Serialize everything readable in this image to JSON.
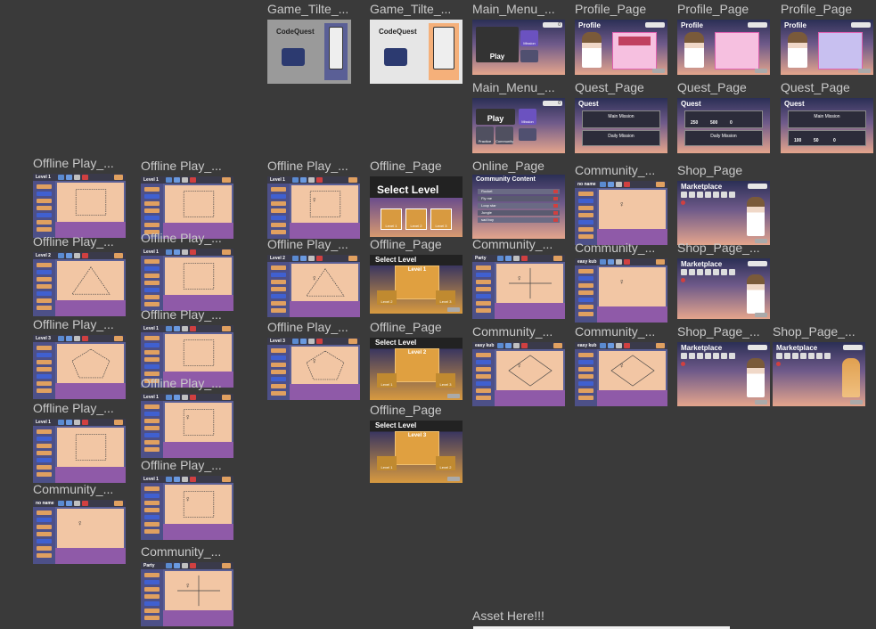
{
  "frames": [
    {
      "title": "Game_Tilte_...",
      "kind": "title",
      "logo": "CodeQuest",
      "variant": "gray"
    },
    {
      "title": "Game_Tilte_...",
      "kind": "title",
      "logo": "CodeQuest",
      "variant": "light"
    },
    {
      "title": "Main_Menu_...",
      "kind": "mainmenu",
      "play": "Play",
      "mission": "Mission",
      "coins": "0"
    },
    {
      "title": "Profile_Page",
      "kind": "profile",
      "header": "Profile",
      "coins": "0",
      "panel": "pinkinfo"
    },
    {
      "title": "Profile_Page",
      "kind": "profile",
      "header": "Profile",
      "coins": "0",
      "panel": "pink"
    },
    {
      "title": "Profile_Page",
      "kind": "profile",
      "header": "Profile",
      "coins": "0",
      "panel": "lavender"
    },
    {
      "title": "Main_Menu_...",
      "kind": "mainmenu2",
      "play": "Play",
      "mission": "Mission",
      "practice": "Practice",
      "community": "Community",
      "coins": "0"
    },
    {
      "title": "Quest_Page",
      "kind": "quest",
      "header": "Quest",
      "main": "Main Mission",
      "daily": "Daily Mission"
    },
    {
      "title": "Quest_Page",
      "kind": "quest2",
      "header": "Quest",
      "v1": "250",
      "v2": "500",
      "v3": "0",
      "daily": "Daily Mission"
    },
    {
      "title": "Quest_Page",
      "kind": "quest3",
      "header": "Quest",
      "main": "Main Mission",
      "v1": "100",
      "v2": "50",
      "v3": "0"
    },
    {
      "title": "Online_Page",
      "kind": "online",
      "header": "Community Content",
      "rows": [
        "Rocket",
        "Fly me",
        "Loop star",
        "Jungle",
        "sad boy"
      ]
    },
    {
      "title": "Community_...",
      "kind": "game",
      "level": "no name",
      "shape": "robot"
    },
    {
      "title": "Shop_Page",
      "kind": "shop",
      "header": "Marketplace",
      "coins": "0"
    },
    {
      "title": "Offline Play_...",
      "kind": "game",
      "level": "Level 1",
      "shape": "square",
      "extra": "Build"
    },
    {
      "title": "Offline Play_...",
      "kind": "game",
      "level": "Level 1",
      "shape": "square"
    },
    {
      "title": "Offline Play_...",
      "kind": "game",
      "level": "Level 1",
      "shape": "square-robot"
    },
    {
      "title": "Offline_Page",
      "kind": "select",
      "header": "Select Level",
      "levels": [
        "Level 1",
        "Level 2",
        "Level 3"
      ]
    },
    {
      "title": "Offline Play_...",
      "kind": "game",
      "level": "Level 2",
      "shape": "triangle"
    },
    {
      "title": "Offline Play_...",
      "kind": "game",
      "level": "Level 1",
      "shape": "square"
    },
    {
      "title": "Offline Play_...",
      "kind": "game",
      "level": "Level 2",
      "shape": "triangle-robot"
    },
    {
      "title": "Offline_Page",
      "kind": "sel1",
      "header": "Select Level",
      "level": "Level 1",
      "levels": [
        "Level 2",
        "Level 3"
      ]
    },
    {
      "title": "Community_...",
      "kind": "game",
      "level": "Party",
      "shape": "cross"
    },
    {
      "title": "Community_...",
      "kind": "game",
      "level": "easy kub",
      "shape": "robot"
    },
    {
      "title": "Shop_Page_...",
      "kind": "shop",
      "header": "Marketplace",
      "coins": "0"
    },
    {
      "title": "Offline Play_...",
      "kind": "game",
      "level": "Level 3",
      "shape": "pentagon"
    },
    {
      "title": "Offline Play_...",
      "kind": "game",
      "level": "Level 1",
      "shape": "square"
    },
    {
      "title": "Offline Play_...",
      "kind": "game",
      "level": "Level 3",
      "shape": "pentagon-robot"
    },
    {
      "title": "Offline_Page",
      "kind": "sel2",
      "header": "Select Level",
      "level": "Level 2",
      "levels": [
        "Level 1",
        "Level 3"
      ]
    },
    {
      "title": "Community_...",
      "kind": "game",
      "level": "easy kub",
      "shape": "diamond"
    },
    {
      "title": "Community_...",
      "kind": "game",
      "level": "easy kub",
      "shape": "diamond"
    },
    {
      "title": "Shop_Page_...",
      "kind": "shop",
      "header": "Marketplace",
      "coins": "0"
    },
    {
      "title": "Shop_Page_...",
      "kind": "shop2",
      "header": "Marketplace",
      "coins": "0"
    },
    {
      "title": "Offline Play_...",
      "kind": "game",
      "level": "Level 1",
      "shape": "square"
    },
    {
      "title": "Offline Play_...",
      "kind": "game",
      "level": "Level 1",
      "shape": "square-robot"
    },
    {
      "title": "Offline_Page",
      "kind": "sel3",
      "header": "Select Level",
      "level": "Level 3",
      "levels": [
        "Level 1",
        "Level 2"
      ]
    },
    {
      "title": "Community_...",
      "kind": "game",
      "level": "no name",
      "shape": "robot"
    },
    {
      "title": "Offline Play_...",
      "kind": "game",
      "level": "Level 1",
      "shape": "square-robot"
    },
    {
      "title": "Community_...",
      "kind": "game",
      "level": "Party",
      "shape": "cross"
    }
  ],
  "asset_label": "Asset Here!!!",
  "colors": {
    "background": "#3a3a3a",
    "title": "#c9c9c9",
    "sidebar": "#4d5088",
    "canvas": "#f2c6a4",
    "ground": "#8f5aa8"
  }
}
